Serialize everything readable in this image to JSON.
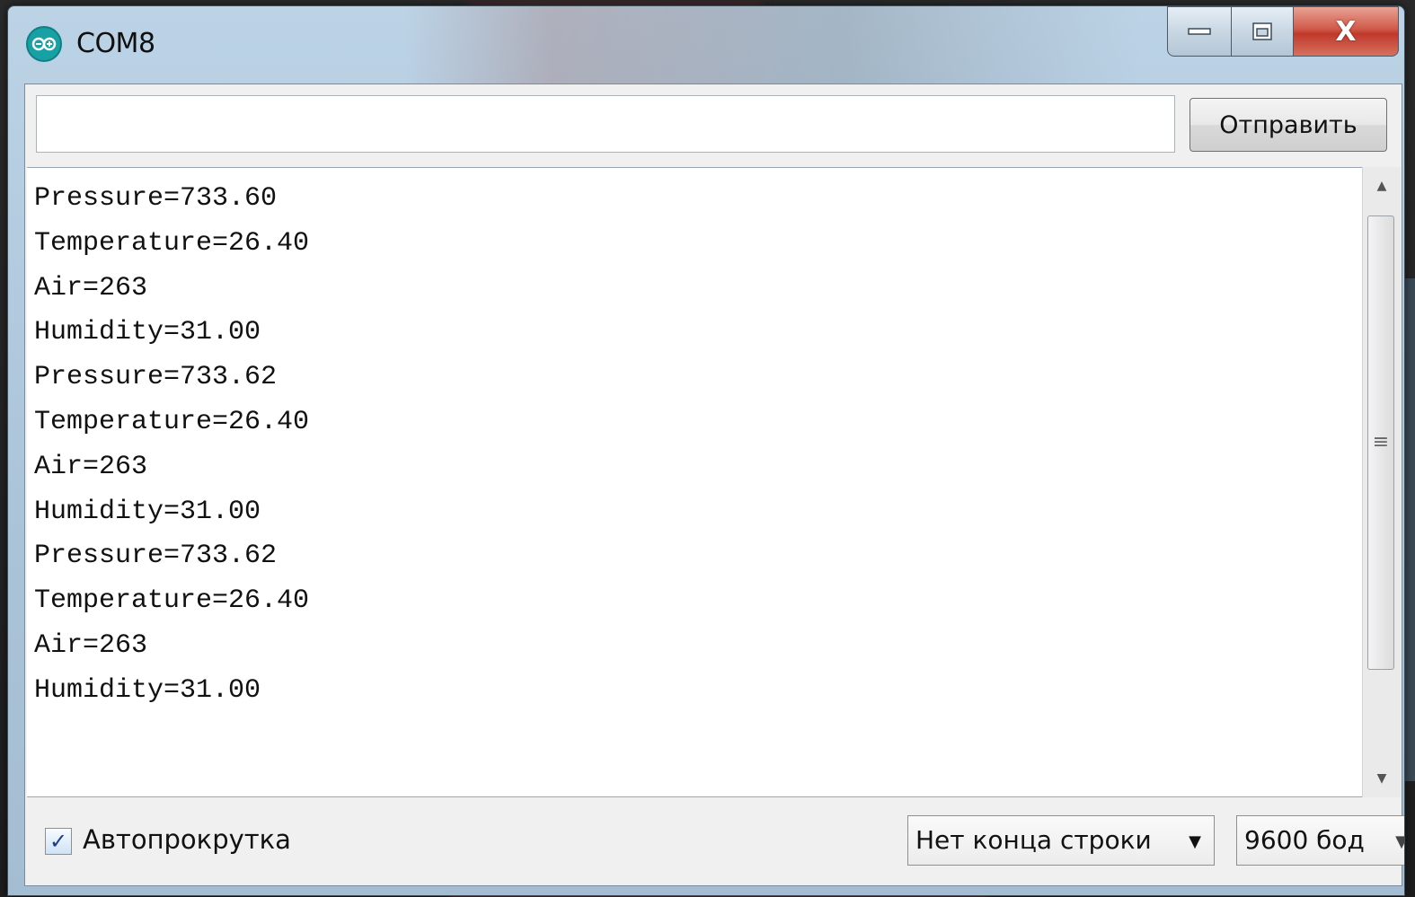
{
  "window": {
    "title": "COM8",
    "icon": "arduino-infinity-icon",
    "controls": {
      "minimize": "minimize-icon",
      "maximize": "maximize-icon",
      "close_label": "X"
    }
  },
  "send_bar": {
    "input_value": "",
    "send_label": "Отправить"
  },
  "serial_output": {
    "lines": [
      "Pressure=733.60",
      "Temperature=26.40",
      "Air=263",
      "Humidity=31.00",
      "Pressure=733.62",
      "Temperature=26.40",
      "Air=263",
      "Humidity=31.00",
      "Pressure=733.62",
      "Temperature=26.40",
      "Air=263",
      "Humidity=31.00"
    ]
  },
  "footer": {
    "autoscroll_label": "Автопрокрутка",
    "autoscroll_checked": true,
    "line_ending": "Нет конца строки",
    "baud_rate": "9600 бод"
  },
  "colors": {
    "arduino_teal": "#17a1a5",
    "close_red": "#c0392b",
    "frame_blue": "#a9c3d9"
  }
}
